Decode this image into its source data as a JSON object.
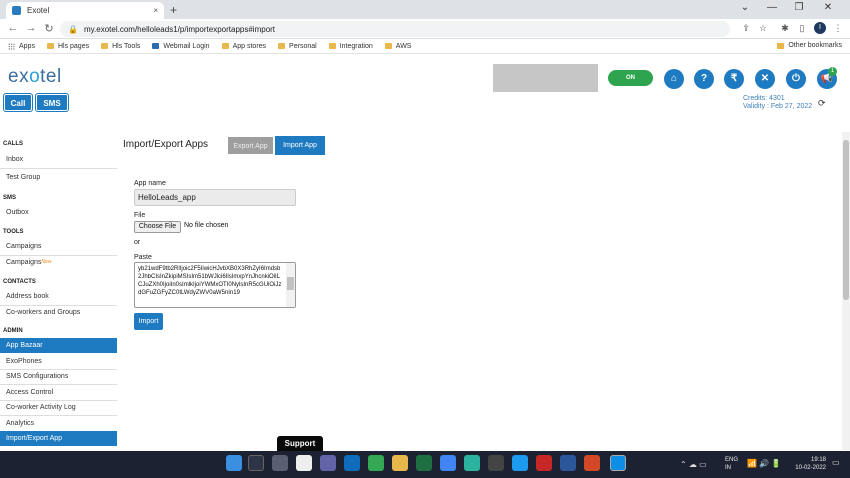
{
  "browser": {
    "tab_title": "Exotel",
    "tab_close": "×",
    "new_tab": "+",
    "url": "my.exotel.com/helloleads1/p/importexportapps#import",
    "window_controls": [
      "⌄",
      "—",
      "❐",
      "✕"
    ],
    "profile_initial": "I",
    "bookmarks": [
      "Apps",
      "Hls pages",
      "Hls Tools",
      "Webmail Login",
      "App stores",
      "Personal",
      "Integration",
      "AWS"
    ],
    "other_bookmarks": "Other bookmarks"
  },
  "header": {
    "logo_prefix": "ex",
    "logo_o": "o",
    "logo_suffix": "tel",
    "call_button": "Call",
    "sms_button": "SMS",
    "on_toggle": "ON",
    "notification_count": "1",
    "credits": "Credits: 4301",
    "validity": "Validity : Feb 27, 2022"
  },
  "sidebar": {
    "calls": {
      "heading": "CALLS",
      "items": [
        "Inbox",
        "Test Group"
      ]
    },
    "sms": {
      "heading": "SMS",
      "items": [
        "Outbox"
      ]
    },
    "tools": {
      "heading": "TOOLS",
      "items": [
        "Campaigns",
        "Campaigns"
      ],
      "new_tag": "New"
    },
    "contacts": {
      "heading": "CONTACTS",
      "items": [
        "Address book",
        "Co-workers and Groups"
      ]
    },
    "admin": {
      "heading": "ADMIN",
      "items": [
        "App Bazaar",
        "ExoPhones",
        "SMS Configurations",
        "Access Control",
        "Co-worker Activity Log",
        "Analytics",
        "Import/Export App"
      ]
    }
  },
  "main": {
    "title": "Import/Export Apps",
    "export_tab": "Export App",
    "import_tab": "Import App",
    "app_name_label": "App name",
    "app_name_value": "HelloLeads_app",
    "file_label": "File",
    "choose_file": "Choose File",
    "no_file": "No file chosen",
    "or_label": "or",
    "paste_label": "Paste",
    "paste_value": "yb21wdF9tb2RlIjoic2F5IiwicHJvbXB0X3RhZyI6Imdsb2JhbCIsInZkipiMSIsIm51bWJlci6IlsImxpYnJhcnkiOiILCJuZXh0IjoiIn0sImlkIjoiYWMxOTI0NylsInR5cGUiOiJzdGFuZGFyZC0tLWdyZWV0aW5nIn19",
    "import_button": "Import"
  },
  "support": "Support",
  "taskbar": {
    "lang": "ENG",
    "lang_sub": "IN",
    "time": "19:18",
    "date": "10-02-2022"
  }
}
